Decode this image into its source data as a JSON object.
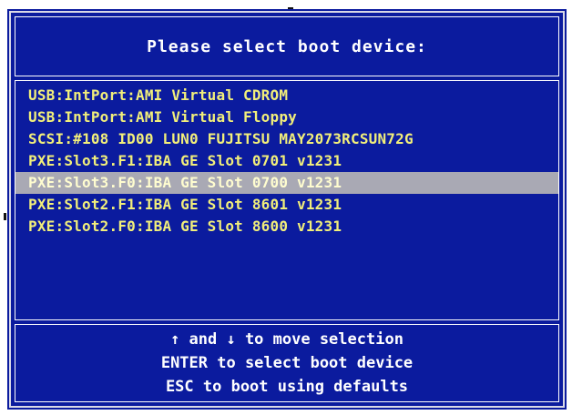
{
  "title": "Please select boot device:",
  "devices": [
    {
      "label": "USB:IntPort:AMI Virtual CDROM"
    },
    {
      "label": "USB:IntPort:AMI Virtual Floppy"
    },
    {
      "label": "SCSI:#108 ID00 LUN0 FUJITSU MAY2073RCSUN72G"
    },
    {
      "label": "PXE:Slot3.F1:IBA GE Slot 0701 v1231"
    },
    {
      "label": "PXE:Slot3.F0:IBA GE Slot 0700 v1231"
    },
    {
      "label": "PXE:Slot2.F1:IBA GE Slot 8601 v1231"
    },
    {
      "label": "PXE:Slot2.F0:IBA GE Slot 8600 v1231"
    }
  ],
  "selected_index": 4,
  "help": {
    "line1": "↑ and ↓ to move selection",
    "line2": "ENTER to select boot device",
    "line3": "ESC to boot using defaults"
  },
  "colors": {
    "background": "#0b1b9e",
    "item_text": "#f2ef7a",
    "selection": "#a9a9b4",
    "help_text": "#ffffff"
  }
}
